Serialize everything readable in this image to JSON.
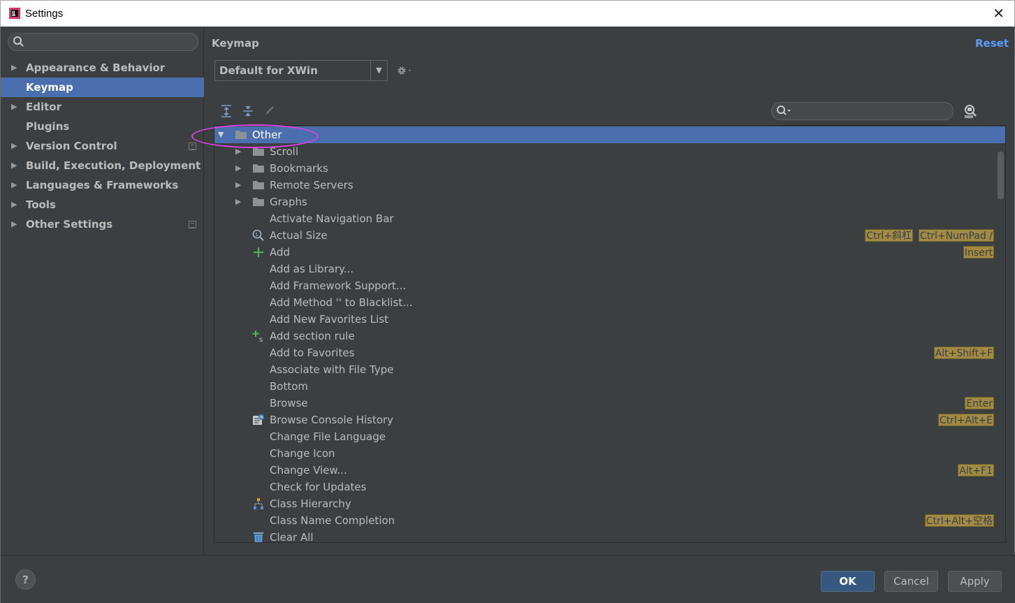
{
  "window": {
    "title": "Settings",
    "close_symbol": "✕"
  },
  "sidebar": {
    "search_placeholder": "",
    "items": [
      {
        "label": "Appearance & Behavior",
        "expandable": true,
        "selected": false,
        "project_icon": false
      },
      {
        "label": "Keymap",
        "expandable": false,
        "selected": true,
        "project_icon": false
      },
      {
        "label": "Editor",
        "expandable": true,
        "selected": false,
        "project_icon": false
      },
      {
        "label": "Plugins",
        "expandable": false,
        "selected": false,
        "project_icon": false
      },
      {
        "label": "Version Control",
        "expandable": true,
        "selected": false,
        "project_icon": true
      },
      {
        "label": "Build, Execution, Deployment",
        "expandable": true,
        "selected": false,
        "project_icon": false
      },
      {
        "label": "Languages & Frameworks",
        "expandable": true,
        "selected": false,
        "project_icon": false
      },
      {
        "label": "Tools",
        "expandable": true,
        "selected": false,
        "project_icon": false
      },
      {
        "label": "Other Settings",
        "expandable": true,
        "selected": false,
        "project_icon": true
      }
    ]
  },
  "main": {
    "title": "Keymap",
    "reset_label": "Reset",
    "keymap_value": "Default for XWin",
    "tree_search_placeholder": ""
  },
  "tree": {
    "rows": [
      {
        "label": "Other",
        "level": 0,
        "arrow": "expanded",
        "icon": "folder-icon",
        "selected": true,
        "shortcuts": []
      },
      {
        "label": "Scroll",
        "level": 1,
        "arrow": "collapsed",
        "icon": "folder-icon",
        "shortcuts": []
      },
      {
        "label": "Bookmarks",
        "level": 1,
        "arrow": "collapsed",
        "icon": "folder-icon",
        "shortcuts": []
      },
      {
        "label": "Remote Servers",
        "level": 1,
        "arrow": "collapsed",
        "icon": "folder-icon",
        "shortcuts": []
      },
      {
        "label": "Graphs",
        "level": 1,
        "arrow": "collapsed",
        "icon": "folder-icon",
        "shortcuts": []
      },
      {
        "label": "Activate Navigation Bar",
        "level": 1,
        "arrow": "",
        "icon": "",
        "shortcuts": []
      },
      {
        "label": "Actual Size",
        "level": 1,
        "arrow": "",
        "icon": "zoom-actual-icon",
        "shortcuts": [
          "Ctrl+NumPad /",
          "Ctrl+斜杠"
        ]
      },
      {
        "label": "Add",
        "level": 1,
        "arrow": "",
        "icon": "plus-icon",
        "shortcuts": [
          "Insert"
        ]
      },
      {
        "label": "Add as Library...",
        "level": 1,
        "arrow": "",
        "icon": "",
        "shortcuts": []
      },
      {
        "label": "Add Framework Support...",
        "level": 1,
        "arrow": "",
        "icon": "",
        "shortcuts": []
      },
      {
        "label": "Add Method '' to Blacklist...",
        "level": 1,
        "arrow": "",
        "icon": "",
        "shortcuts": []
      },
      {
        "label": "Add New Favorites List",
        "level": 1,
        "arrow": "",
        "icon": "",
        "shortcuts": []
      },
      {
        "label": "Add section rule",
        "level": 1,
        "arrow": "",
        "icon": "add-section-icon",
        "shortcuts": []
      },
      {
        "label": "Add to Favorites",
        "level": 1,
        "arrow": "",
        "icon": "",
        "shortcuts": [
          "Alt+Shift+F"
        ]
      },
      {
        "label": "Associate with File Type",
        "level": 1,
        "arrow": "",
        "icon": "",
        "shortcuts": []
      },
      {
        "label": "Bottom",
        "level": 1,
        "arrow": "",
        "icon": "",
        "shortcuts": []
      },
      {
        "label": "Browse",
        "level": 1,
        "arrow": "",
        "icon": "",
        "shortcuts": [
          "Enter"
        ]
      },
      {
        "label": "Browse Console History",
        "level": 1,
        "arrow": "",
        "icon": "console-history-icon",
        "shortcuts": [
          "Ctrl+Alt+E"
        ]
      },
      {
        "label": "Change File Language",
        "level": 1,
        "arrow": "",
        "icon": "",
        "shortcuts": []
      },
      {
        "label": "Change Icon",
        "level": 1,
        "arrow": "",
        "icon": "",
        "shortcuts": []
      },
      {
        "label": "Change View...",
        "level": 1,
        "arrow": "",
        "icon": "",
        "shortcuts": [
          "Alt+F1"
        ]
      },
      {
        "label": "Check for Updates",
        "level": 1,
        "arrow": "",
        "icon": "",
        "shortcuts": []
      },
      {
        "label": "Class Hierarchy",
        "level": 1,
        "arrow": "",
        "icon": "hierarchy-icon",
        "shortcuts": []
      },
      {
        "label": "Class Name Completion",
        "level": 1,
        "arrow": "",
        "icon": "",
        "shortcuts": [
          "Ctrl+Alt+空格"
        ]
      },
      {
        "label": "Clear All",
        "level": 1,
        "arrow": "",
        "icon": "trash-icon",
        "shortcuts": []
      }
    ]
  },
  "footer": {
    "help_symbol": "?",
    "ok_label": "OK",
    "cancel_label": "Cancel",
    "apply_label": "Apply"
  },
  "colors": {
    "background": "#3c3f41",
    "selection": "#4b6eaf",
    "shortcut_badge": "#a08a45",
    "link": "#589df6",
    "annotation_ellipse": "#e040e0"
  }
}
